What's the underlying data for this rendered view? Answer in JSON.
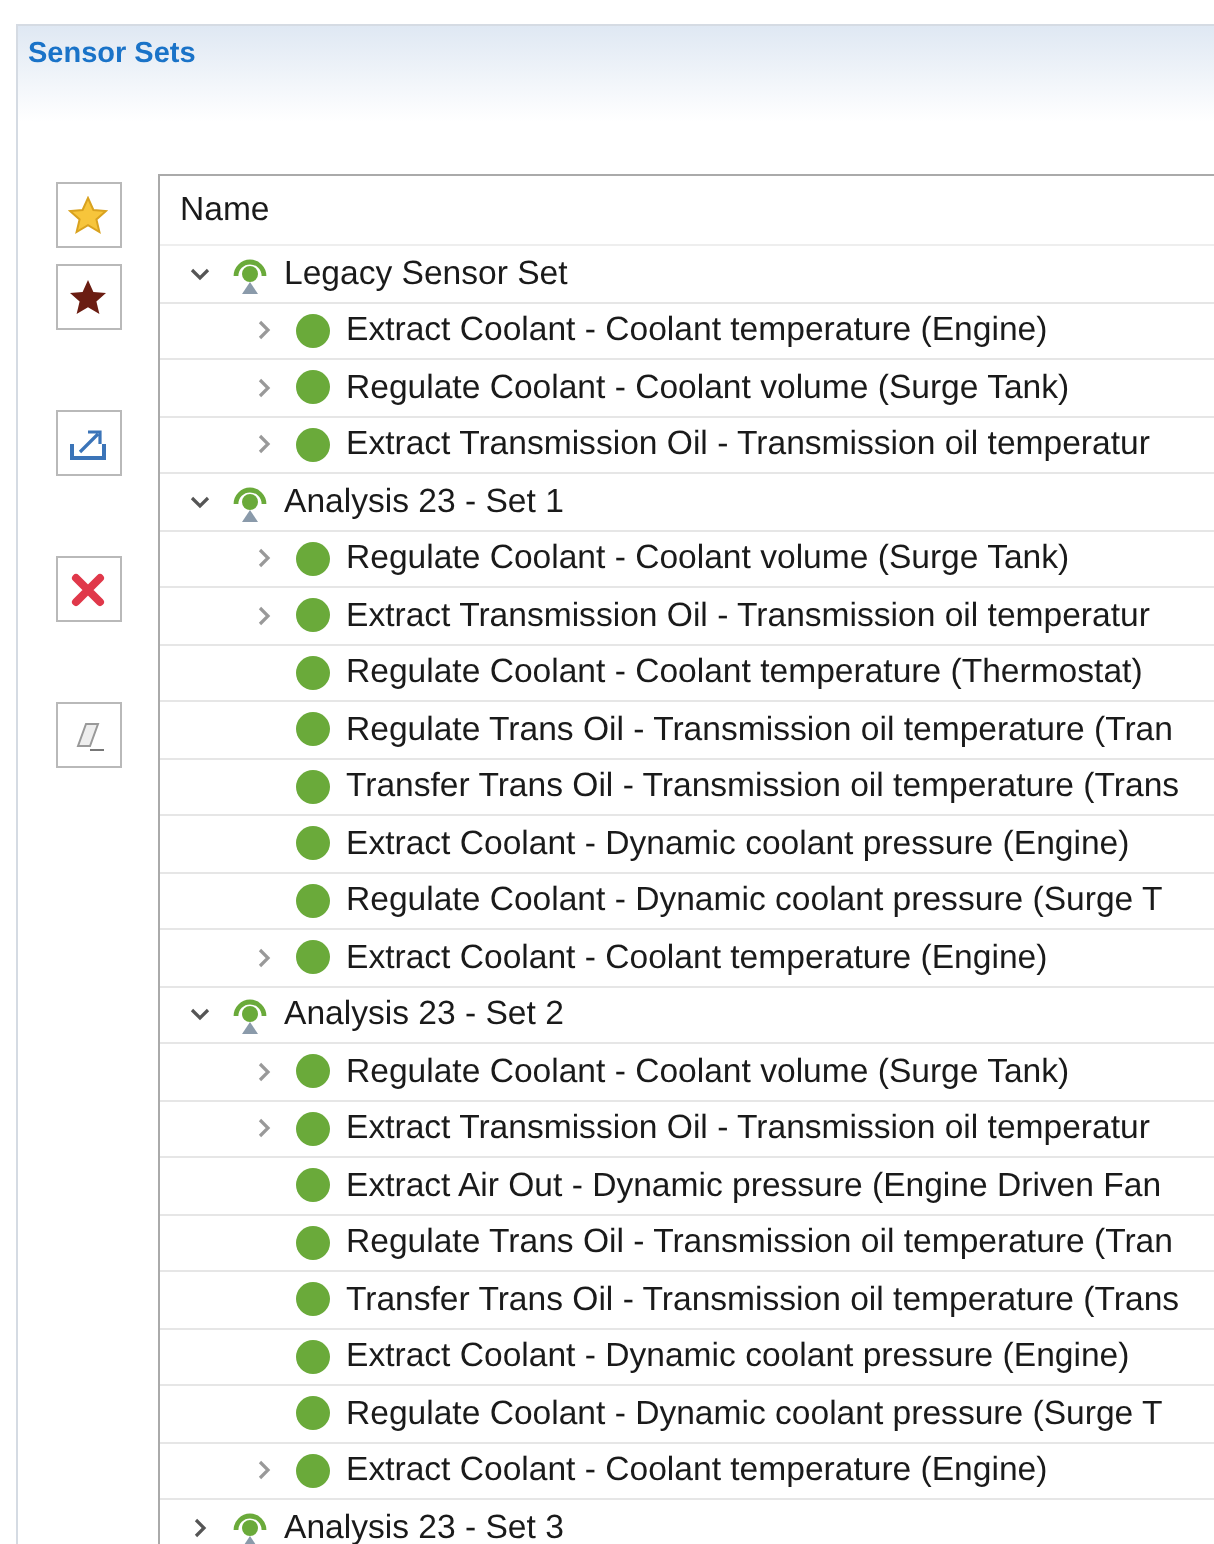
{
  "panel": {
    "title": "Sensor Sets"
  },
  "toolbar": [
    {
      "kind": "favorite"
    },
    {
      "kind": "favorite-dark"
    },
    {
      "kind": "export"
    },
    {
      "kind": "delete"
    },
    {
      "kind": "clear"
    }
  ],
  "tree": {
    "column": "Name",
    "sets": [
      {
        "label": "Legacy Sensor Set",
        "expanded": true,
        "children": [
          {
            "label": "Extract Coolant - Coolant temperature (Engine)",
            "expandable": true
          },
          {
            "label": "Regulate Coolant - Coolant volume (Surge Tank)",
            "expandable": true
          },
          {
            "label": "Extract Transmission Oil - Transmission oil temperatur",
            "expandable": true
          }
        ]
      },
      {
        "label": "Analysis 23 - Set 1",
        "expanded": true,
        "children": [
          {
            "label": "Regulate Coolant - Coolant volume (Surge Tank)",
            "expandable": true
          },
          {
            "label": "Extract Transmission Oil - Transmission oil temperatur",
            "expandable": true
          },
          {
            "label": "Regulate Coolant - Coolant temperature (Thermostat)",
            "expandable": false
          },
          {
            "label": "Regulate Trans Oil - Transmission oil temperature (Tran",
            "expandable": false
          },
          {
            "label": "Transfer Trans Oil - Transmission oil temperature (Trans",
            "expandable": false
          },
          {
            "label": "Extract Coolant - Dynamic coolant pressure (Engine)",
            "expandable": false
          },
          {
            "label": "Regulate Coolant - Dynamic coolant pressure (Surge T",
            "expandable": false
          },
          {
            "label": "Extract Coolant - Coolant temperature (Engine)",
            "expandable": true
          }
        ]
      },
      {
        "label": "Analysis 23 - Set 2",
        "expanded": true,
        "children": [
          {
            "label": "Regulate Coolant - Coolant volume (Surge Tank)",
            "expandable": true
          },
          {
            "label": "Extract Transmission Oil - Transmission oil temperatur",
            "expandable": true
          },
          {
            "label": "Extract Air Out - Dynamic pressure (Engine Driven Fan",
            "expandable": false
          },
          {
            "label": "Regulate Trans Oil - Transmission oil temperature (Tran",
            "expandable": false
          },
          {
            "label": "Transfer Trans Oil - Transmission oil temperature (Trans",
            "expandable": false
          },
          {
            "label": "Extract Coolant - Dynamic coolant pressure (Engine)",
            "expandable": false
          },
          {
            "label": "Regulate Coolant - Dynamic coolant pressure (Surge T",
            "expandable": false
          },
          {
            "label": "Extract Coolant - Coolant temperature (Engine)",
            "expandable": true
          }
        ]
      },
      {
        "label": "Analysis 23 - Set 3",
        "expanded": false
      }
    ]
  }
}
